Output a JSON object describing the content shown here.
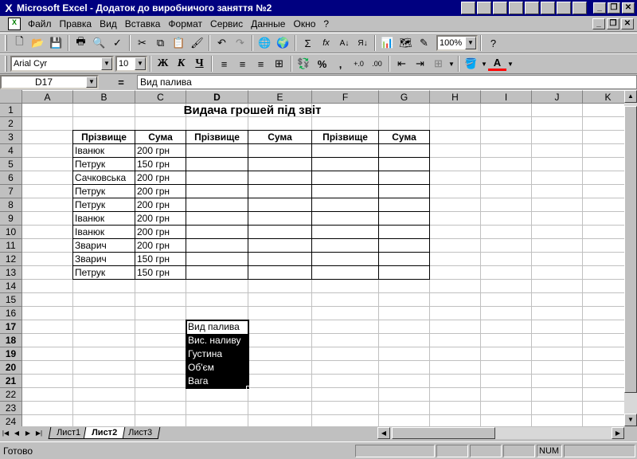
{
  "window": {
    "title": "Microsoft Excel - Додаток до виробничого заняття №2",
    "minimize": "_",
    "restore": "❐",
    "close": "✕"
  },
  "menu": [
    "Файл",
    "Правка",
    "Вид",
    "Вставка",
    "Формат",
    "Сервис",
    "Данные",
    "Окно",
    "?"
  ],
  "toolbar": {
    "zoom": "100%",
    "font_name": "Arial Cyr",
    "font_size": "10",
    "bold": "Ж",
    "italic": "К",
    "underline": "Ч",
    "percent": "%",
    "comma": ",",
    "sum": "Σ",
    "function": "fx"
  },
  "formula_bar": {
    "name_box": "D17",
    "equals": "=",
    "content": "Вид палива"
  },
  "columns": [
    "A",
    "B",
    "C",
    "D",
    "E",
    "F",
    "G",
    "H",
    "I",
    "J",
    "K"
  ],
  "active_column": "D",
  "rows": [
    "1",
    "2",
    "3",
    "4",
    "5",
    "6",
    "7",
    "8",
    "9",
    "10",
    "11",
    "12",
    "13",
    "14",
    "15",
    "16",
    "17",
    "18",
    "19",
    "20",
    "21",
    "22",
    "23",
    "24"
  ],
  "active_rows": [
    "17",
    "18",
    "19",
    "20",
    "21"
  ],
  "sheet": {
    "title": "Видача грошей під звіт",
    "headers": [
      "Прізвище",
      "Сума",
      "Прізвище",
      "Сума",
      "Прізвище",
      "Сума"
    ],
    "table_rows": [
      [
        "Іванюк",
        "200 грн"
      ],
      [
        "Петрук",
        "150 грн"
      ],
      [
        "Сачковська",
        "200 грн"
      ],
      [
        "Петрук",
        "200 грн"
      ],
      [
        "Петрук",
        "200 грн"
      ],
      [
        "Іванюк",
        "200 грн"
      ],
      [
        "Іванюк",
        "200 грн"
      ],
      [
        "Зварич",
        "200 грн"
      ],
      [
        "Зварич",
        "150 грн"
      ],
      [
        "Петрук",
        "150 грн"
      ]
    ],
    "selection": [
      "Вид палива",
      "Вис. наливу",
      "Густина",
      "Об'єм",
      "Вага"
    ]
  },
  "tabs": [
    "Лист1",
    "Лист2",
    "Лист3"
  ],
  "active_tab": "Лист2",
  "status": {
    "text": "Готово",
    "num": "NUM"
  }
}
